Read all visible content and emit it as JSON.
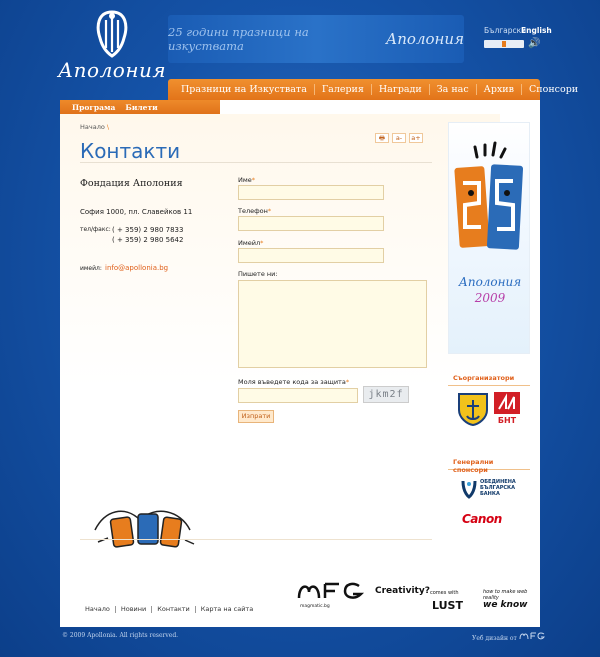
{
  "header": {
    "logo_text": "Аполония",
    "banner_text": "25 години празници на изкуствата",
    "banner_logo": "Аполония",
    "languages": [
      "Български",
      "English"
    ],
    "icons": {
      "logo": "apollonia-lyre-icon",
      "sound": "speaker-icon"
    }
  },
  "main_nav": [
    "Празници на Изкуствата",
    "Галерия",
    "Награди",
    "За нас",
    "Архив",
    "Спонсори"
  ],
  "sub_nav": [
    "Програма",
    "Билети"
  ],
  "breadcrumb": {
    "home": "Начало",
    "separator": "\\"
  },
  "tools": {
    "print": "🖶",
    "smaller": "a-",
    "larger": "a+"
  },
  "page_title": "Контакти",
  "contact": {
    "org_name": "Фондация Аполония",
    "address": "София 1000, пл. Славейков 11",
    "tel_label": "тел/факс:",
    "tel1": "( + 359) 2 980 7833",
    "tel2": "( + 359) 2 980 5642",
    "email_label": "имейл:",
    "email": "info@apollonia.bg"
  },
  "form": {
    "name_label": "Име",
    "phone_label": "Телефон",
    "email_label": "Имейл",
    "message_label": "Пишете ни:",
    "captcha_label": "Моля въведете кода за защита",
    "captcha_code": "jkm2f",
    "required_mark": "*",
    "submit_label": "Изпрати"
  },
  "sidebar": {
    "banner_title": "Аполония",
    "banner_year": "2009",
    "coorganizers_heading": "Съорганизатори",
    "sponsors_heading": "Генерални спонсори",
    "bank_name": "ОБЕДИНЕНА БЪЛГАРСКА БАНКА",
    "canon": "Canon",
    "bnt": "БНТ"
  },
  "footer": {
    "links": [
      "Начало",
      "Новини",
      "Контакти",
      "Карта на сайта"
    ],
    "sponsor_caption": "magmatic.bg",
    "creativity": "Creativity?",
    "comes_with": "comes with",
    "lust": "LUST",
    "how_to": "how to make web reality",
    "we_know": "we know",
    "copyright": "© 2009 Apollonia. All rights reserved.",
    "webdesign": "Уеб дизайн от"
  },
  "colors": {
    "accent": "#e77d1e",
    "brand_blue": "#2b6bb7",
    "background": "#1553a8"
  }
}
